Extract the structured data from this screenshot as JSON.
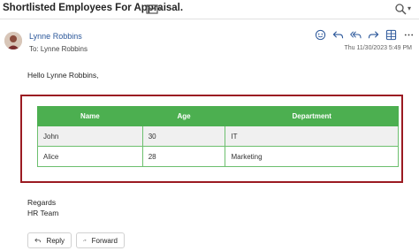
{
  "header": {
    "subject": "Shortlisted Employees For Appraisal.",
    "icons": [
      "envelope-icon",
      "chevron-down-icon",
      "zoom-icon"
    ]
  },
  "message": {
    "sender_name": "Lynne Robbins",
    "to_label": "To:",
    "to_name": "Lynne Robbins",
    "datetime": "Thu 11/30/2023 5:49 PM",
    "action_icons": [
      "emoji-icon",
      "reply-icon",
      "reply-all-icon",
      "forward-icon",
      "table-view-icon",
      "more-icon"
    ],
    "accent_color": "#2b579a"
  },
  "body": {
    "greeting": "Hello Lynne Robbins,",
    "table": {
      "header_color": "#4caf50",
      "columns": [
        "Name",
        "Age",
        "Department"
      ],
      "rows": [
        [
          "John",
          "30",
          "IT"
        ],
        [
          "Alice",
          "28",
          "Marketing"
        ]
      ]
    },
    "highlight_color": "#9b1b22",
    "regards": "Regards",
    "signature": "HR Team"
  },
  "footer": {
    "reply_label": "Reply",
    "forward_label": "Forward"
  }
}
